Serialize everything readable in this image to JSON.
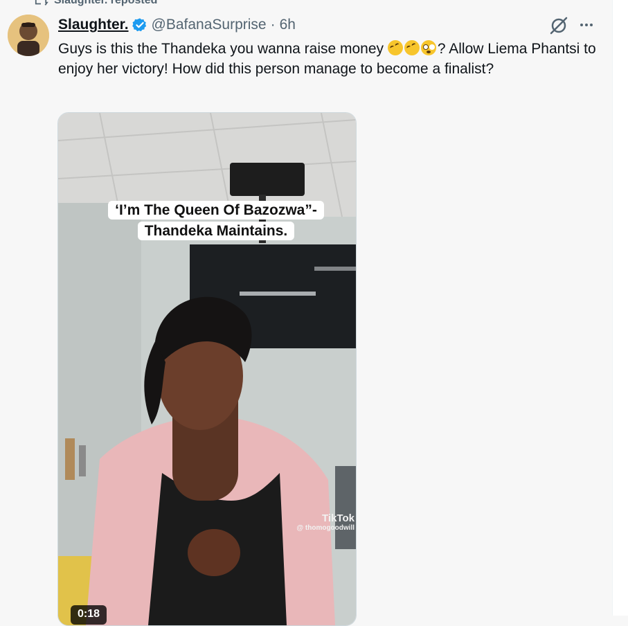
{
  "repost": {
    "text": "Slaughter. reposted"
  },
  "tweet": {
    "display_name": "Slaughter.",
    "handle": "@BafanaSurprise",
    "separator": "·",
    "time": "6h",
    "text_part1": "Guys is this the Thandeka you wanna raise money ",
    "text_part2": "? Allow Liema Phantsi to enjoy her victory! How did this person manage to become a finalist?",
    "emojis": [
      "rolling-on-floor-laughing",
      "rolling-on-floor-laughing",
      "flushed-face"
    ]
  },
  "video": {
    "caption_line1": "‘I’m The Queen Of Bazozwa”-",
    "caption_line2": "Thandeka Maintains.",
    "watermark_logo": "TikTok",
    "watermark_user": "@ thomogoodwill",
    "timestamp": "0:18"
  },
  "colors": {
    "accent": "#1d9bf0",
    "text": "#0f1419",
    "muted": "#536471"
  }
}
